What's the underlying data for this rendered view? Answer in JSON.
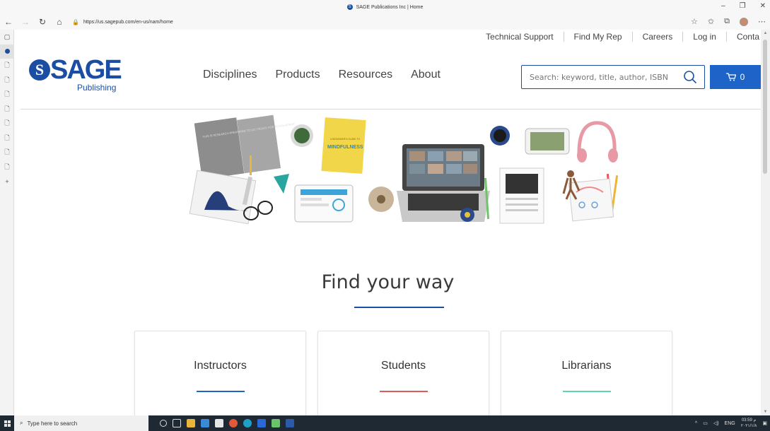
{
  "browser": {
    "tab_title": "SAGE Publications Inc | Home",
    "url": "https://us.sagepub.com/en-us/nam/home",
    "window_controls": [
      "–",
      "❐",
      "✕"
    ]
  },
  "utility_nav": [
    "Technical Support",
    "Find My Rep",
    "Careers",
    "Log in",
    "Conta"
  ],
  "logo": {
    "word": "SAGE",
    "sub": "Publishing",
    "seal_glyph": "S"
  },
  "main_nav": [
    "Disciplines",
    "Products",
    "Resources",
    "About"
  ],
  "search": {
    "placeholder": "Search: keyword, title, author, ISBN"
  },
  "cart": {
    "count": "0"
  },
  "hero": {
    "book_title": "MINDFULNESS",
    "book_prefix": "A BEGINNER'S GUIDE TO",
    "notebook_text": "THIS IS RESEARCH PREPARING TO GET READY FOR SCHOLARSHIP"
  },
  "find_your_way": {
    "heading": "Find your way"
  },
  "cards": [
    {
      "label": "Instructors",
      "color": "#1e64c8"
    },
    {
      "label": "Students",
      "color": "#e05a5a"
    },
    {
      "label": "Librarians",
      "color": "#5cd6b0"
    }
  ],
  "taskbar": {
    "search_placeholder": "Type here to search",
    "lang": "ENG",
    "time": "03:59 م",
    "date": "٢٠٢١/١/٨"
  },
  "colors": {
    "brand": "#1b4ea3",
    "cart_bg": "#1e64c8"
  }
}
